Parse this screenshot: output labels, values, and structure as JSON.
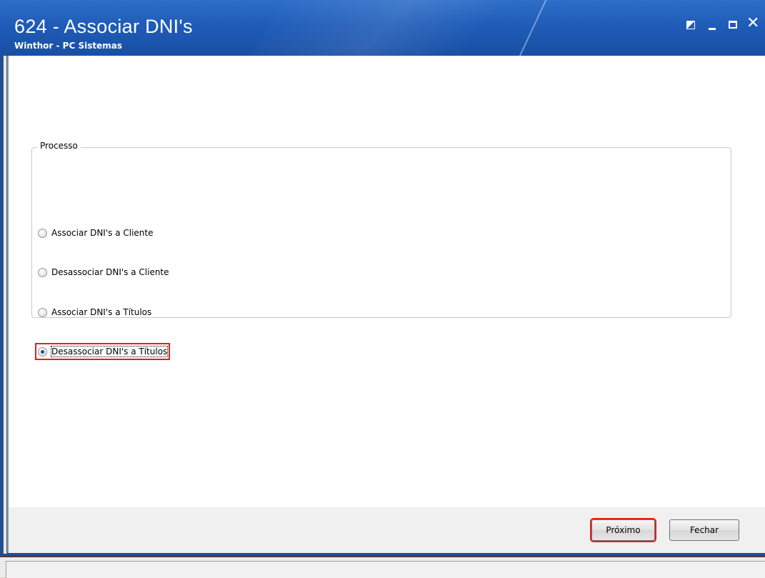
{
  "window": {
    "title": "624 - Associar DNI's",
    "subtitle": "Winthor - PC Sistemas"
  },
  "group": {
    "label": "Processo",
    "options": [
      {
        "label": "Associar DNI's a Cliente",
        "selected": false
      },
      {
        "label": "Desassociar DNI's a Cliente",
        "selected": false
      },
      {
        "label": "Associar DNI's a Títulos",
        "selected": false
      },
      {
        "label": "Desassociar DNI's a Títulos",
        "selected": true
      }
    ]
  },
  "buttons": {
    "next_label": "Próximo",
    "close_label": "Fechar"
  },
  "colors": {
    "titlebar": "#1f5cb8",
    "highlight": "#e02020"
  }
}
